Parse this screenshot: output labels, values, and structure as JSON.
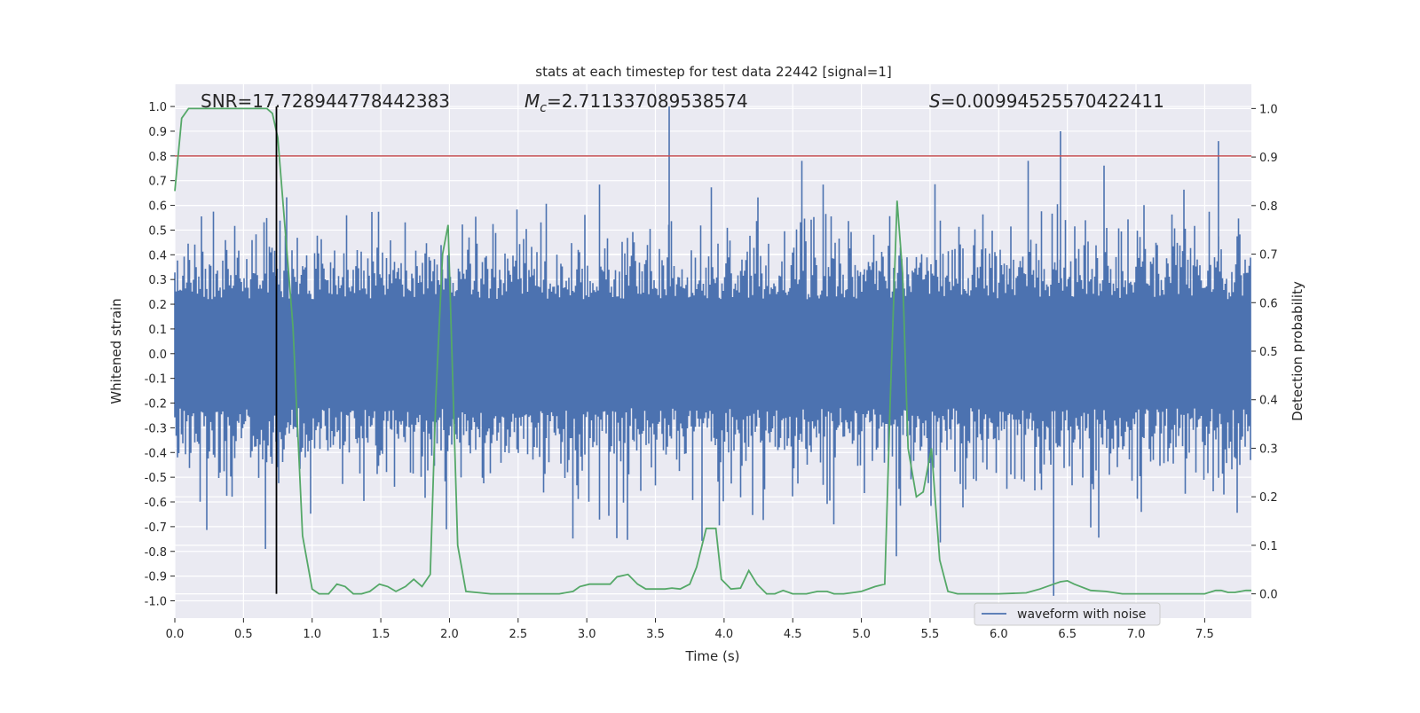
{
  "chart_data": {
    "type": "line",
    "title": "stats at each timestep for test data 22442 [signal=1]",
    "xlabel": "Time (s)",
    "ylabel": "Whitened strain",
    "ylabel_right": "Detection probability",
    "xlim": [
      0,
      7.84
    ],
    "ylim": [
      -1.07,
      1.09
    ],
    "ylim_right": [
      -0.05,
      1.05
    ],
    "x_ticks": [
      "0.0",
      "0.5",
      "1.0",
      "1.5",
      "2.0",
      "2.5",
      "3.0",
      "3.5",
      "4.0",
      "4.5",
      "5.0",
      "5.5",
      "6.0",
      "6.5",
      "7.0",
      "7.5"
    ],
    "y_ticks": [
      "1.0",
      "0.9",
      "0.8",
      "0.7",
      "0.6",
      "0.5",
      "0.4",
      "0.3",
      "0.2",
      "0.1",
      "0.0",
      "-0.1",
      "-0.2",
      "-0.3",
      "-0.4",
      "-0.5",
      "-0.6",
      "-0.7",
      "-0.8",
      "-0.9",
      "-1.0"
    ],
    "y_ticks_right": [
      "1.0",
      "0.9",
      "0.8",
      "0.7",
      "0.6",
      "0.5",
      "0.4",
      "0.3",
      "0.2",
      "0.1",
      "0.0"
    ],
    "grid": true,
    "legend": {
      "position": "lower-right",
      "entries": [
        "waveform with noise"
      ]
    },
    "annotations": {
      "snr": "SNR=17.728944778442383",
      "mc_symbol": "M",
      "mc_sub": "c",
      "mc_value": "=2.711337089538574",
      "s_symbol": "S",
      "s_value": "=0.00994525570422411"
    },
    "threshold_line": {
      "y": 0.8,
      "axis": "left",
      "color": "#c44e52"
    },
    "marker_line": {
      "x": 0.74,
      "color": "#000000"
    },
    "colors": {
      "waveform": "#4c72b0",
      "probability": "#55a868",
      "background": "#eaeaf2"
    },
    "series": [
      {
        "name": "waveform with noise",
        "axis": "left",
        "style": "dense noise, core band about ±0.2 with spikes to about ±0.7",
        "notable_extrema": [
          {
            "x": 0.66,
            "y": -0.79
          },
          {
            "x": 3.6,
            "y": 1.0
          },
          {
            "x": 6.4,
            "y": -0.98
          },
          {
            "x": 6.45,
            "y": 0.9
          },
          {
            "x": 7.6,
            "y": 0.86
          }
        ]
      },
      {
        "axis": "right",
        "x": [
          0.0,
          0.05,
          0.1,
          0.67,
          0.71,
          0.75,
          0.86,
          0.93,
          1.0,
          1.05,
          1.12,
          1.18,
          1.24,
          1.3,
          1.36,
          1.42,
          1.49,
          1.55,
          1.61,
          1.68,
          1.74,
          1.8,
          1.86,
          1.9,
          1.95,
          1.99,
          2.06,
          2.12,
          2.3,
          2.8,
          2.9,
          2.95,
          3.02,
          3.1,
          3.17,
          3.22,
          3.3,
          3.37,
          3.43,
          3.57,
          3.62,
          3.68,
          3.75,
          3.8,
          3.87,
          3.94,
          3.98,
          4.05,
          4.12,
          4.18,
          4.24,
          4.31,
          4.37,
          4.43,
          4.5,
          4.6,
          4.68,
          4.75,
          4.8,
          4.87,
          4.95,
          5.0,
          5.1,
          5.17,
          5.21,
          5.26,
          5.3,
          5.34,
          5.4,
          5.45,
          5.51,
          5.57,
          5.63,
          5.7,
          5.85,
          6.0,
          6.2,
          6.3,
          6.4,
          6.45,
          6.5,
          6.55,
          6.67,
          6.78,
          6.9,
          7.0,
          7.3,
          7.5,
          7.58,
          7.62,
          7.67,
          7.72,
          7.8,
          7.84
        ],
        "y": [
          0.83,
          0.98,
          1.0,
          1.0,
          0.99,
          0.94,
          0.55,
          0.12,
          0.01,
          0.0,
          0.0,
          0.02,
          0.015,
          0.0,
          0.0,
          0.005,
          0.02,
          0.015,
          0.005,
          0.015,
          0.03,
          0.015,
          0.04,
          0.4,
          0.7,
          0.76,
          0.1,
          0.005,
          0.0,
          0.0,
          0.005,
          0.015,
          0.02,
          0.02,
          0.02,
          0.035,
          0.04,
          0.02,
          0.01,
          0.01,
          0.012,
          0.01,
          0.02,
          0.055,
          0.135,
          0.135,
          0.03,
          0.01,
          0.012,
          0.048,
          0.02,
          0.0,
          0.0,
          0.007,
          0.0,
          0.0,
          0.005,
          0.005,
          0.0,
          0.0,
          0.003,
          0.005,
          0.015,
          0.02,
          0.4,
          0.81,
          0.66,
          0.3,
          0.2,
          0.21,
          0.3,
          0.07,
          0.005,
          0.0,
          0.0,
          0.0,
          0.002,
          0.01,
          0.02,
          0.025,
          0.027,
          0.02,
          0.007,
          0.005,
          0.0,
          0.0,
          0.0,
          0.0,
          0.007,
          0.007,
          0.003,
          0.003,
          0.007,
          0.007
        ]
      }
    ]
  }
}
